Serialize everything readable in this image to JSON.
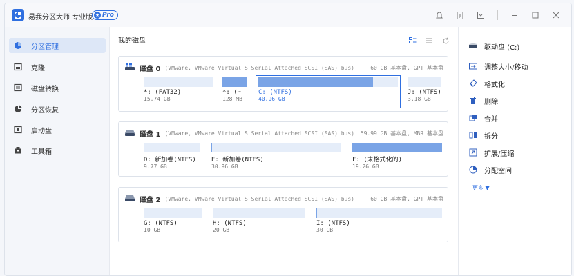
{
  "app": {
    "title": "易我分区大师 专业版",
    "badge": "Pro"
  },
  "sidebar": {
    "items": [
      {
        "label": "分区管理",
        "icon": "pie-chart-icon",
        "active": true
      },
      {
        "label": "克隆",
        "icon": "clone-icon"
      },
      {
        "label": "磁盘转换",
        "icon": "disk-convert-icon"
      },
      {
        "label": "分区恢复",
        "icon": "recovery-icon"
      },
      {
        "label": "启动盘",
        "icon": "bootdisk-icon"
      },
      {
        "label": "工具箱",
        "icon": "toolbox-icon"
      }
    ]
  },
  "main": {
    "title": "我的磁盘",
    "disks": [
      {
        "name": "磁盘 0",
        "desc": "(VMware,  VMware Virtual S Serial Attached SCSI (SAS) bus)",
        "info": "60 GB 基本盘, GPT 基本盘",
        "partitions": [
          {
            "label": "*: (FAT32)",
            "size": "15.74 GB",
            "fill": 0.0
          },
          {
            "label": "*: (⋯",
            "size": "128 MB",
            "fill": 1.0
          },
          {
            "label": "C: (NTFS)",
            "size": "40.96 GB",
            "fill": 0.82,
            "selected": true
          },
          {
            "label": "J: (NTFS)",
            "size": "3.18 GB",
            "fill": 0.0
          }
        ]
      },
      {
        "name": "磁盘 1",
        "desc": "(VMware,  VMware Virtual S Serial Attached SCSI (SAS) bus)",
        "info": "59.99 GB 基本盘, MBR 基本盘",
        "partitions": [
          {
            "label": "D: 新加卷(NTFS)",
            "size": "9.77 GB",
            "fill": 0.0
          },
          {
            "label": "E: 新加卷(NTFS)",
            "size": "30.96 GB",
            "fill": 0.0
          },
          {
            "label": "F: (未格式化的)",
            "size": "19.26 GB",
            "fill": 1.0
          }
        ]
      },
      {
        "name": "磁盘 2",
        "desc": "(VMware,  VMware Virtual S Serial Attached SCSI (SAS) bus)",
        "info": "60 GB 基本盘, GPT 基本盘",
        "partitions": [
          {
            "label": "G: (NTFS)",
            "size": "10 GB",
            "fill": 0.0
          },
          {
            "label": "H: (NTFS)",
            "size": "20 GB",
            "fill": 0.0
          },
          {
            "label": "I: (NTFS)",
            "size": "30 GB",
            "fill": 0.0
          }
        ]
      }
    ]
  },
  "rightpanel": {
    "drive_title": "驱动盘  (C:)",
    "actions": [
      {
        "label": "调整大小/移动",
        "icon": "resize-icon"
      },
      {
        "label": "格式化",
        "icon": "format-icon"
      },
      {
        "label": "删除",
        "icon": "trash-icon"
      },
      {
        "label": "合并",
        "icon": "merge-icon"
      },
      {
        "label": "拆分",
        "icon": "split-icon"
      },
      {
        "label": "扩展/压缩",
        "icon": "extend-icon"
      },
      {
        "label": "分配空间",
        "icon": "allocate-icon"
      }
    ],
    "more": "更多 ▼"
  },
  "colors": {
    "accent": "#2f6fe0",
    "bar_fill": "#7aa4e6",
    "bar_empty": "#e5edf9"
  }
}
